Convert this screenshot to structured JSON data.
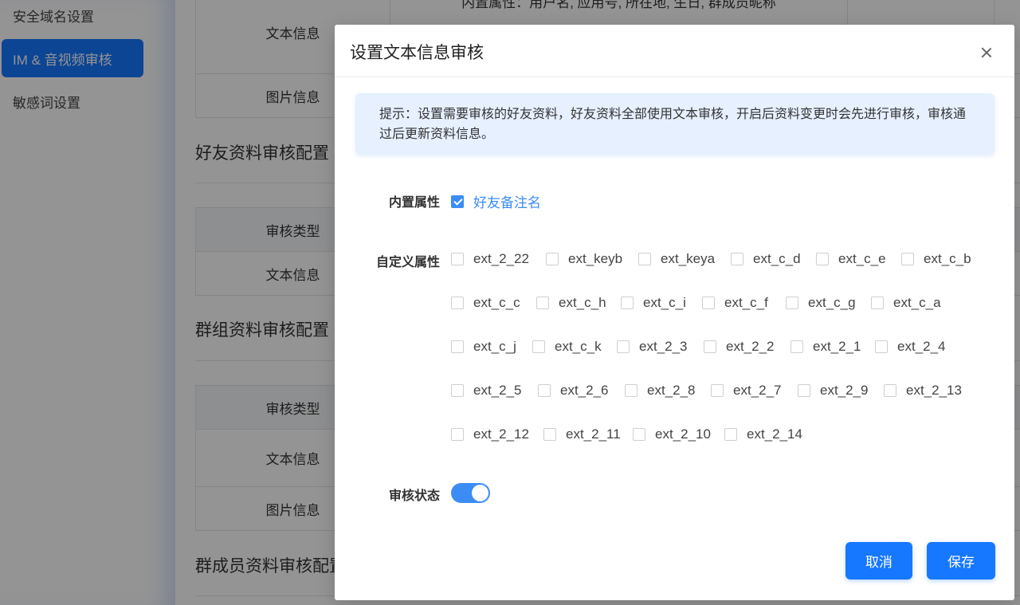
{
  "sidebar": {
    "items": [
      {
        "label": "安全域名设置",
        "active": false
      },
      {
        "label": "IM & 音视频审核",
        "active": true
      },
      {
        "label": "敏感词设置",
        "active": false
      }
    ]
  },
  "page": {
    "table1": {
      "rows": [
        {
          "type": "文本信息",
          "detail": "内置属性：用户名, 应用号, 所在地, 生日, 群成员昵称"
        },
        {
          "type": "图片信息",
          "detail": ""
        }
      ]
    },
    "friend_section": {
      "title": "好友资料审核配置",
      "header": "审核类型",
      "rows": [
        "文本信息"
      ]
    },
    "group_section": {
      "title": "群组资料审核配置",
      "header": "审核类型",
      "rows": [
        "文本信息",
        "图片信息"
      ]
    },
    "member_section": {
      "title": "群成员资料审核配置"
    }
  },
  "dialog": {
    "title": "设置文本信息审核",
    "tip": "提示：设置需要审核的好友资料，好友资料全部使用文本审核，开启后资料变更时会先进行审核，审核通过后更新资料信息。",
    "builtin_label": "内置属性",
    "builtin_options": [
      {
        "label": "好友备注名",
        "checked": true
      }
    ],
    "custom_label": "自定义属性",
    "custom_options": [
      [
        "ext_2_22",
        "ext_keyb",
        "ext_keya",
        "ext_c_d",
        "ext_c_e",
        "ext_c_b"
      ],
      [
        "ext_c_c",
        "ext_c_h",
        "ext_c_i",
        "ext_c_f",
        "ext_c_g",
        "ext_c_a"
      ],
      [
        "ext_c_j",
        "ext_c_k",
        "ext_2_3",
        "ext_2_2",
        "ext_2_1",
        "ext_2_4"
      ],
      [
        "ext_2_5",
        "ext_2_6",
        "ext_2_8",
        "ext_2_7",
        "ext_2_9",
        "ext_2_13"
      ],
      [
        "ext_2_12",
        "ext_2_11",
        "ext_2_10",
        "ext_2_14"
      ]
    ],
    "status_label": "审核状态",
    "status_enabled": true,
    "cancel_label": "取消",
    "save_label": "保存"
  }
}
